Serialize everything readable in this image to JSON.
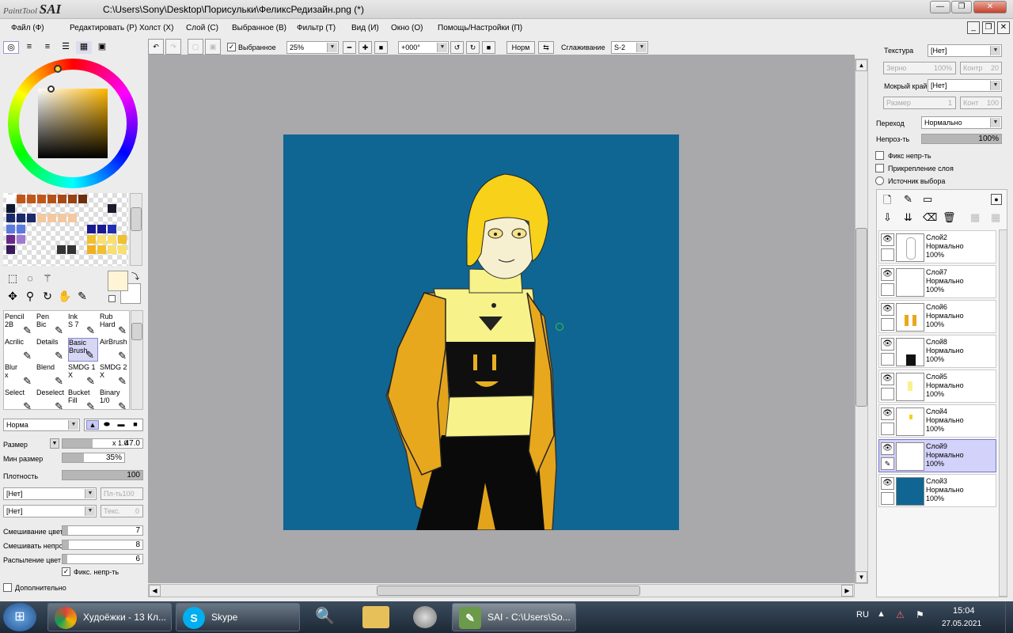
{
  "title_bar": {
    "logo_small": "PaintTool",
    "logo_big": "SAI",
    "path": "C:\\Users\\Sony\\Desktop\\Порисульки\\ФеликсРедизайн.png (*)"
  },
  "menu": [
    "Файл (Ф)",
    "Редактировать (Р)",
    "Холст (Х)",
    "Слой (С)",
    "Выбранное (В)",
    "Фильтр (Т)",
    "Вид (И)",
    "Окно (О)",
    "Помощь/Настройки (П)"
  ],
  "toolbar": {
    "selection_label": "Выбранное",
    "selection_checked": true,
    "zoom": "25%",
    "rotation": "+000°",
    "blend_btn": "Норм",
    "smoothing_label": "Сглаживание",
    "smoothing_value": "S-2"
  },
  "left": {
    "brush_tools": [
      {
        "name": "Pencil",
        "sub": "2B"
      },
      {
        "name": "Pen",
        "sub": "Bic"
      },
      {
        "name": "Ink",
        "sub": "S 7"
      },
      {
        "name": "Rub",
        "sub": "Hard"
      },
      {
        "name": "Acrilic",
        "sub": ""
      },
      {
        "name": "Details",
        "sub": ""
      },
      {
        "name": "Basic",
        "sub": "Brush"
      },
      {
        "name": "AirBrush",
        "sub": ""
      },
      {
        "name": "Blur",
        "sub": "x"
      },
      {
        "name": "Blend",
        "sub": ""
      },
      {
        "name": "SMDG 1",
        "sub": "X"
      },
      {
        "name": "SMDG 2",
        "sub": "X"
      },
      {
        "name": "Select",
        "sub": ""
      },
      {
        "name": "Deselect",
        "sub": ""
      },
      {
        "name": "Bucket",
        "sub": "Fill"
      },
      {
        "name": "Binary",
        "sub": "1/0"
      }
    ],
    "selected_tool": "Basic",
    "blend_mode": "Норма",
    "size_label": "Размер",
    "size_mult": "x 1.0",
    "size_value": "47.0",
    "min_size_label": "Мин размер",
    "min_size_value": "35%",
    "density_label": "Плотность",
    "density_value": "100",
    "texture1": "[Нет]",
    "texture1_val": "Пл-ть100",
    "texture2": "[Нет]",
    "texture2_val": "Текс.",
    "texture2_num": "0",
    "mix_label": "Смешивание цвет",
    "mix_value": "7",
    "mix2_label": "Смешивать непрс",
    "mix2_value": "8",
    "spray_label": "Распыление цвет",
    "spray_value": "6",
    "keep_opacity": "Фикс. непр-ть",
    "advanced": "Дополнительно"
  },
  "right": {
    "texture_label": "Текстура",
    "texture_value": "[Нет]",
    "grain_label": "Зерно",
    "grain_value": "100%",
    "contrast_label": "Контр",
    "contrast_value": "20",
    "wet_label": "Мокрый край",
    "wet_value": "[Нет]",
    "size_label": "Размер",
    "size_value": "1",
    "contrast2_label": "Конт",
    "contrast2_value": "100",
    "mode_label": "Переход",
    "mode_value": "Нормально",
    "opacity_label": "Непроз-ть",
    "opacity_value": "100%",
    "fix_opacity": "Фикс непр-ть",
    "clip_layer": "Прикрепление слоя",
    "selection_source": "Источник выбора",
    "layers": [
      {
        "name": "Слой2",
        "mode": "Нормально",
        "opacity": "100%",
        "selected": false,
        "thumb": "sketch"
      },
      {
        "name": "Слой7",
        "mode": "Нормально",
        "opacity": "100%",
        "selected": false,
        "thumb": "empty"
      },
      {
        "name": "Слой6",
        "mode": "Нормально",
        "opacity": "100%",
        "selected": false,
        "thumb": "yellow"
      },
      {
        "name": "Слой8",
        "mode": "Нормально",
        "opacity": "100%",
        "selected": false,
        "thumb": "black"
      },
      {
        "name": "Слой5",
        "mode": "Нормально",
        "opacity": "100%",
        "selected": false,
        "thumb": "yellow-small"
      },
      {
        "name": "Слой4",
        "mode": "Нормально",
        "opacity": "100%",
        "selected": false,
        "thumb": "yellow-tiny"
      },
      {
        "name": "Слой9",
        "mode": "Нормально",
        "opacity": "100%",
        "selected": true,
        "thumb": "empty"
      },
      {
        "name": "Слой3",
        "mode": "Нормально",
        "opacity": "100%",
        "selected": false,
        "thumb": "blue"
      }
    ]
  },
  "taskbar": {
    "items": [
      {
        "label": "Худоёжки - 13 Кл...",
        "icon": "chrome-icon"
      },
      {
        "label": "Skype",
        "icon": "skype-icon"
      },
      {
        "label": "SAI - C:\\Users\\So...",
        "icon": "sai-icon"
      }
    ],
    "lang": "RU",
    "time": "15:04",
    "date": "27.05.2021"
  },
  "colors": {
    "canvas_bg": "#0F6693",
    "canvas_area": "#A9A8AB",
    "primary_color": "#FFF4D6",
    "layer_selected": "#D2D2FA"
  }
}
